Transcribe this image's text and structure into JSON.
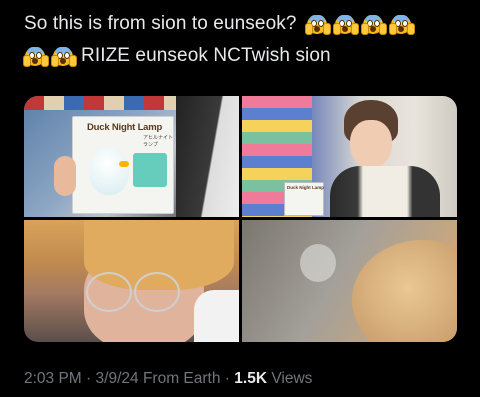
{
  "tweet": {
    "line1": "So this is from sion to eunseok?",
    "line2": "RIIZE eunseok NCTwish sion",
    "emoji_icon": "face-screaming-in-fear-icon",
    "line1_emoji_count": 4,
    "line2_emoji_count": 2
  },
  "media": {
    "box_title": "Duck Night Lamp",
    "box_subtitle": "アヒルナイトランプ",
    "mini_box_title": "Duck Night Lamp"
  },
  "meta": {
    "time": "2:03 PM",
    "date": "3/9/24",
    "source": "From Earth",
    "views_count": "1.5K",
    "views_label": "Views",
    "separator": "·"
  },
  "colors": {
    "background": "#000000",
    "text": "#e7e9ea",
    "muted": "#71767b"
  }
}
